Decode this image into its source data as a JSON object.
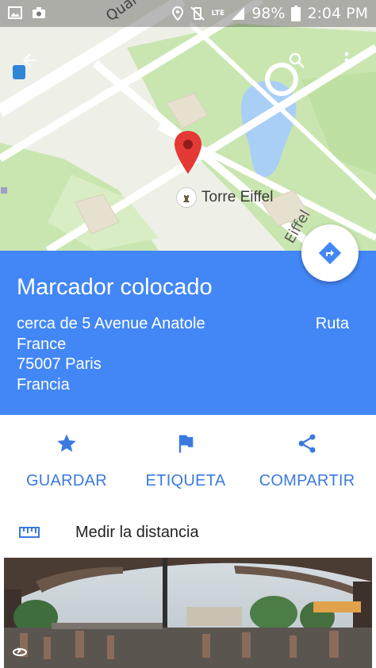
{
  "status_bar": {
    "battery": "98%",
    "time": "2:04 PM",
    "network": "LTE"
  },
  "map": {
    "street_label_top": "Quai Bra",
    "street_label_right": "Eiffel",
    "poi_label": "Torre Eiffel"
  },
  "place": {
    "title": "Marcador colocado",
    "address_lines": [
      "cerca de 5 Avenue Anatole",
      "France",
      "75007 Paris",
      "Francia"
    ],
    "route_label": "Ruta"
  },
  "actions": {
    "save": "GUARDAR",
    "label": "ETIQUETA",
    "share": "COMPARTIR"
  },
  "measure": {
    "label": "Medir la distancia"
  },
  "colors": {
    "accent_blue": "#4287f5",
    "action_blue": "#3a7ae0",
    "pin_red": "#e53935",
    "park_green": "#c9e6b0",
    "water_blue": "#a9cff7"
  }
}
